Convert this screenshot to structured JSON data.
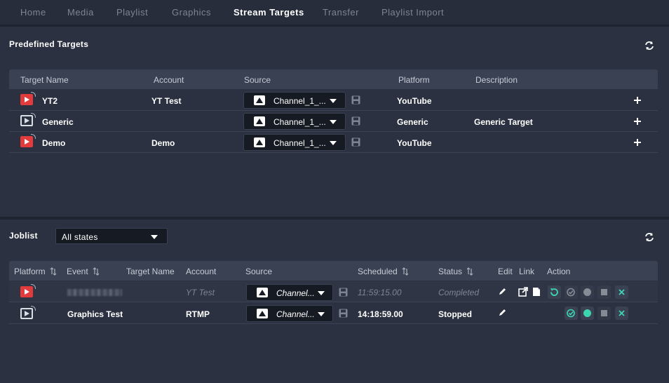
{
  "nav": {
    "tabs": [
      {
        "label": "Home",
        "active": false
      },
      {
        "label": "Media",
        "active": false
      },
      {
        "label": "Playlist",
        "active": false
      },
      {
        "label": "Graphics",
        "active": false
      },
      {
        "label": "Stream Targets",
        "active": true
      },
      {
        "label": "Transfer",
        "active": false
      },
      {
        "label": "Playlist Import",
        "active": false
      }
    ]
  },
  "predefined": {
    "title": "Predefined Targets",
    "columns": {
      "name": "Target Name",
      "account": "Account",
      "source": "Source",
      "platform": "Platform",
      "description": "Description"
    },
    "rows": [
      {
        "icon": "youtube-icon",
        "name": "YT2",
        "account": "YT Test",
        "source": "Channel_1_...",
        "platform": "YouTube",
        "description": ""
      },
      {
        "icon": "generic-stream-icon",
        "name": "Generic",
        "account": "",
        "source": "Channel_1_...",
        "platform": "Generic",
        "description": "Generic Target"
      },
      {
        "icon": "youtube-icon",
        "name": "Demo",
        "account": "Demo",
        "source": "Channel_1_...",
        "platform": "YouTube",
        "description": ""
      }
    ]
  },
  "joblist": {
    "title": "Joblist",
    "state_filter": "All states",
    "columns": {
      "platform": "Platform",
      "event": "Event",
      "target": "Target Name",
      "account": "Account",
      "source": "Source",
      "scheduled": "Scheduled",
      "status": "Status",
      "edit": "Edit",
      "link": "Link",
      "action": "Action"
    },
    "rows": [
      {
        "icon": "youtube-icon",
        "event": "",
        "target": "",
        "account": "YT Test",
        "source": "Channel...",
        "scheduled": "11:59:15.00",
        "status": "Completed"
      },
      {
        "icon": "generic-stream-icon",
        "event": "Graphics Test",
        "target": "",
        "account": "RTMP",
        "source": "Channel...",
        "scheduled": "14:18:59.00",
        "status": "Stopped"
      }
    ]
  },
  "colors": {
    "accent": "#3dd6b0",
    "youtube_red": "#e23b3b",
    "background": "#2b3140",
    "header_row": "#3a4152"
  }
}
